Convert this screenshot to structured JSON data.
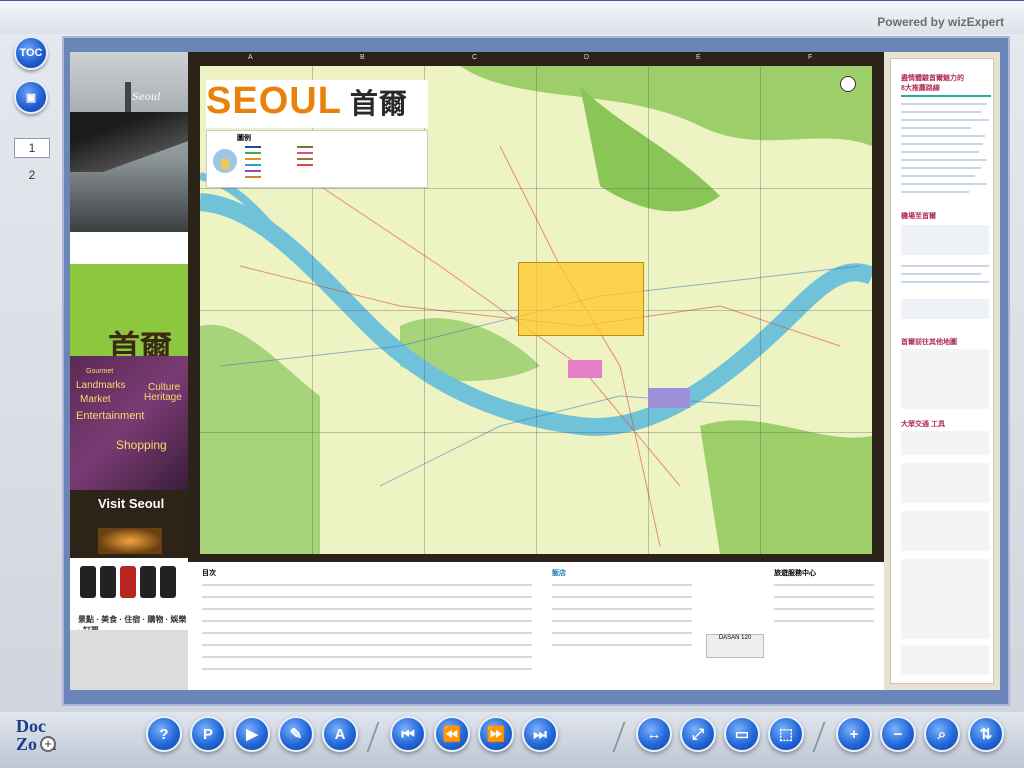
{
  "header": {
    "powered_by": "Powered by wizExpert"
  },
  "sidebar": {
    "toc_label": "TOC",
    "pages": [
      "1",
      "2"
    ],
    "current_page": "1"
  },
  "document": {
    "map_title": "SEOUL",
    "map_title_cn": "首爾",
    "legend_title": "圖例",
    "columns": [
      "A",
      "B",
      "C",
      "D",
      "E",
      "F"
    ],
    "rows": [
      "1",
      "2",
      "3",
      "4"
    ],
    "cover": {
      "seoul_script": "Seoul",
      "chinese_title": "首爾",
      "visit_title": "Visit Seoul",
      "phones_caption": "景點 · 美食 · 住宿 · 購物 · 娛樂 · 訂票",
      "categories": [
        "Landmarks",
        "Market",
        "Entertainment",
        "Shopping",
        "Culture",
        "Heritage",
        "Gourmet"
      ]
    },
    "index": {
      "catalog_title": "目次",
      "hotels_title": "飯店",
      "info_center_title": "旅遊服務中心",
      "dasan_label": "DASAN 120"
    },
    "right_panel": {
      "title_1": "盡情體驗首爾魅力的",
      "title_2": "8大推薦路線",
      "section_airport": "機場至首爾",
      "section_other": "首爾前往其他地圖",
      "section_transport": "大眾交通 工具"
    }
  },
  "toolbar": {
    "buttons": [
      {
        "name": "help-button",
        "glyph": "?"
      },
      {
        "name": "save-pdf-button",
        "glyph": "P"
      },
      {
        "name": "play-button",
        "glyph": "▶"
      },
      {
        "name": "annotate-button",
        "glyph": "✎"
      },
      {
        "name": "text-button",
        "glyph": "A"
      },
      {
        "name": "first-page-button",
        "glyph": "⏮"
      },
      {
        "name": "prev-page-button",
        "glyph": "⏪"
      },
      {
        "name": "next-page-button",
        "glyph": "⏩"
      },
      {
        "name": "last-page-button",
        "glyph": "⏭"
      },
      {
        "name": "fit-width-button",
        "glyph": "↔"
      },
      {
        "name": "fullscreen-button",
        "glyph": "⤢"
      },
      {
        "name": "book-view-button",
        "glyph": "▭"
      },
      {
        "name": "single-page-button",
        "glyph": "⬚"
      },
      {
        "name": "zoom-in-button",
        "glyph": "+"
      },
      {
        "name": "zoom-out-button",
        "glyph": "−"
      },
      {
        "name": "zoom-fit-button",
        "glyph": "⌕"
      },
      {
        "name": "rotate-button",
        "glyph": "⇅"
      }
    ],
    "logo_doc": "Doc",
    "logo_zoom": "Zo m"
  }
}
